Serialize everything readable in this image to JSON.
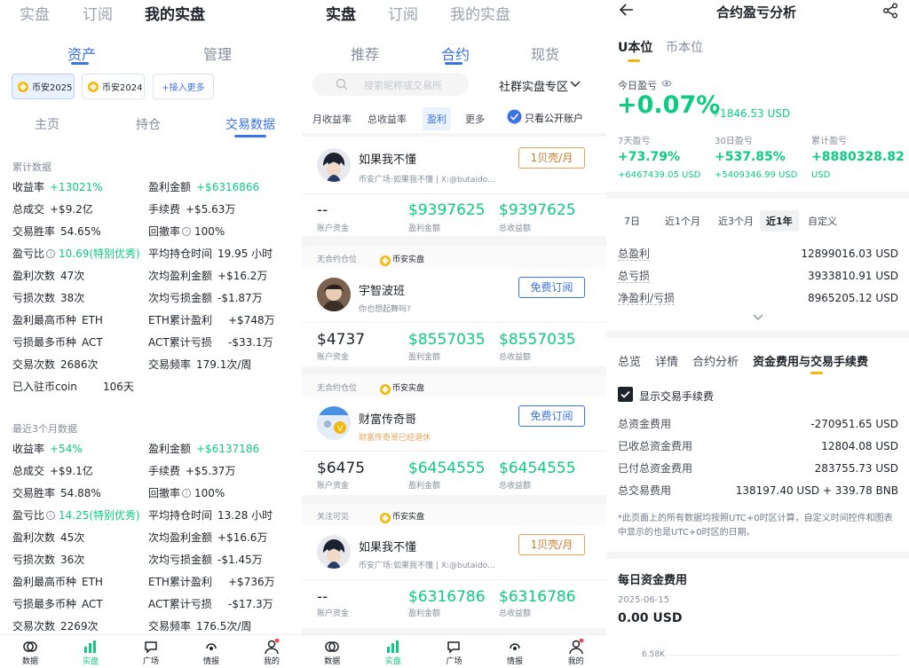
{
  "p1": {
    "tabs": [
      "实盘",
      "订阅",
      "我的实盘"
    ],
    "sub_tabs": [
      "资产",
      "管理"
    ],
    "accounts": [
      "币安2025",
      "币安2024",
      "+接入更多"
    ],
    "inner_tabs": [
      "主页",
      "持仓",
      "交易数据"
    ],
    "sec1": "累计数据",
    "rows1": [
      {
        "l": "收益率",
        "v": "+13021%",
        "r": "盈利金额",
        "rv": "+$6316866",
        "g": true,
        "rg": true
      },
      {
        "l": "总成交",
        "v": "+$9.2亿",
        "r": "手续费",
        "rv": "+$5.63万"
      },
      {
        "l": "交易胜率",
        "v": "54.65%",
        "r": "回撤率",
        "rv": "100%",
        "ri": true
      },
      {
        "l": "盈亏比",
        "v": "10.69(特别优秀)",
        "r": "平均持仓时间",
        "rv": "19.95 小时",
        "li": true
      },
      {
        "l": "盈利次数",
        "v": "47次",
        "r": "次均盈利金额",
        "rv": "+$16.2万"
      },
      {
        "l": "亏损次数",
        "v": "38次",
        "r": "次均亏损金额",
        "rv": "-$1.87万"
      },
      {
        "l": "盈利最高币种",
        "v": "ETH",
        "r": "ETH累计盈利",
        "rv": "+$748万"
      },
      {
        "l": "亏损最多币种",
        "v": "ACT",
        "r": "ACT累计亏损",
        "rv": "-$33.1万"
      },
      {
        "l": "交易次数",
        "v": "2686次",
        "r": "交易频率",
        "rv": "179.1次/周"
      },
      {
        "l": "已入驻币coin",
        "v": "106天"
      }
    ],
    "sec2": "最近3个月数据",
    "rows2": [
      {
        "l": "收益率",
        "v": "+54%",
        "r": "盈利金额",
        "rv": "+$6137186",
        "g": true,
        "rg": true
      },
      {
        "l": "总成交",
        "v": "+$9.1亿",
        "r": "手续费",
        "rv": "+$5.37万"
      },
      {
        "l": "交易胜率",
        "v": "54.88%",
        "r": "回撤率",
        "rv": "100%",
        "ri": true
      },
      {
        "l": "盈亏比",
        "v": "14.25(特别优秀)",
        "r": "平均持仓时间",
        "rv": "13.28 小时",
        "li": true
      },
      {
        "l": "盈利次数",
        "v": "45次",
        "r": "次均盈利金额",
        "rv": "+$16.6万"
      },
      {
        "l": "亏损次数",
        "v": "36次",
        "r": "次均亏损金额",
        "rv": "-$1.45万"
      },
      {
        "l": "盈利最高币种",
        "v": "ETH",
        "r": "ETH累计盈利",
        "rv": "+$736万"
      },
      {
        "l": "亏损最多币种",
        "v": "ACT",
        "r": "ACT累计亏损",
        "rv": "-$17.3万"
      },
      {
        "l": "交易次数",
        "v": "2269次",
        "r": "交易频率",
        "rv": "176.5次/周"
      }
    ]
  },
  "nav": [
    "数据",
    "实盘",
    "广场",
    "情报",
    "我的"
  ],
  "p2": {
    "tabs": [
      "实盘",
      "订阅",
      "我的实盘"
    ],
    "sub_tabs": [
      "推荐",
      "合约",
      "现货"
    ],
    "search_placeholder": "搜索昵称或交易所",
    "zone": "社群实盘专区",
    "filters": [
      "月收益率",
      "总收益率",
      "盈利",
      "更多"
    ],
    "public_only": "只看公开账户",
    "badge": "币安实盘",
    "cards": [
      {
        "name": "如果我不懂",
        "desc": "币安广场:如果我不懂 | X:@butaido...",
        "btn": "1贝壳/月",
        "btn_or": true,
        "fund": "--",
        "profit": "$9397625",
        "total": "$9397625",
        "tag": ""
      },
      {
        "name": "宇智波班",
        "desc": "你也想起舞吗?",
        "btn": "免费订阅",
        "btn_or": false,
        "fund": "$4737",
        "profit": "$8557035",
        "total": "$8557035",
        "tag": "无合约仓位"
      },
      {
        "name": "财富传奇哥",
        "desc": "财富传奇哥已经退休",
        "btn": "免费订阅",
        "btn_or": false,
        "fund": "$6475",
        "profit": "$6454555",
        "total": "$6454555",
        "tag": "无合约仓位"
      },
      {
        "name": "如果我不懂",
        "desc": "币安广场:如果我不懂 | X:@butaido...",
        "btn": "1贝壳/月",
        "btn_or": true,
        "fund": "--",
        "profit": "$6316786",
        "total": "$6316786",
        "tag": "关注可见"
      }
    ],
    "cap_fund": "账户资金",
    "cap_profit": "盈利金额",
    "cap_total": "总收益额"
  },
  "p3": {
    "title": "合约盈亏分析",
    "units": [
      "U本位",
      "币本位"
    ],
    "today_label": "今日盈亏",
    "today_pct": "+0.07%",
    "today_amt": "+1846.53 USD",
    "periods": [
      {
        "label": "7天盈亏",
        "pct": "+73.79%",
        "amt": "+6467439.05 USD"
      },
      {
        "label": "30日盈亏",
        "pct": "+537.85%",
        "amt": "+5409346.99 USD"
      },
      {
        "label": "累计盈亏",
        "pct": "+8880328.82",
        "amt": "USD"
      }
    ],
    "ranges": [
      "7日",
      "近1个月",
      "近3个月",
      "近1年",
      "自定义"
    ],
    "summary": [
      {
        "l": "总盈利",
        "v": "12899016.03 USD"
      },
      {
        "l": "总亏损",
        "v": "3933810.91 USD"
      },
      {
        "l": "净盈利/亏损",
        "v": "8965205.12 USD"
      }
    ],
    "tabs2": [
      "总览",
      "详情",
      "合约分析",
      "资金费用与交易手续费"
    ],
    "show_fee": "显示交易手续费",
    "fees": [
      {
        "l": "总资金费用",
        "v": "-270951.65 USD"
      },
      {
        "l": "已收总资金费用",
        "v": "12804.08 USD"
      },
      {
        "l": "已付总资金费用",
        "v": "283755.73 USD"
      },
      {
        "l": "总交易费用",
        "v": "138197.40 USD + 339.78 BNB"
      }
    ],
    "note": "*此页面上的所有数据均按照UTC+0时区计算，自定义时间控件和图表中显示的也是UTC+0时区的日期。",
    "daily_title": "每日资金费用",
    "daily_date": "2025-06-15",
    "daily_val": "0.00 USD",
    "axis": "6.58K"
  }
}
